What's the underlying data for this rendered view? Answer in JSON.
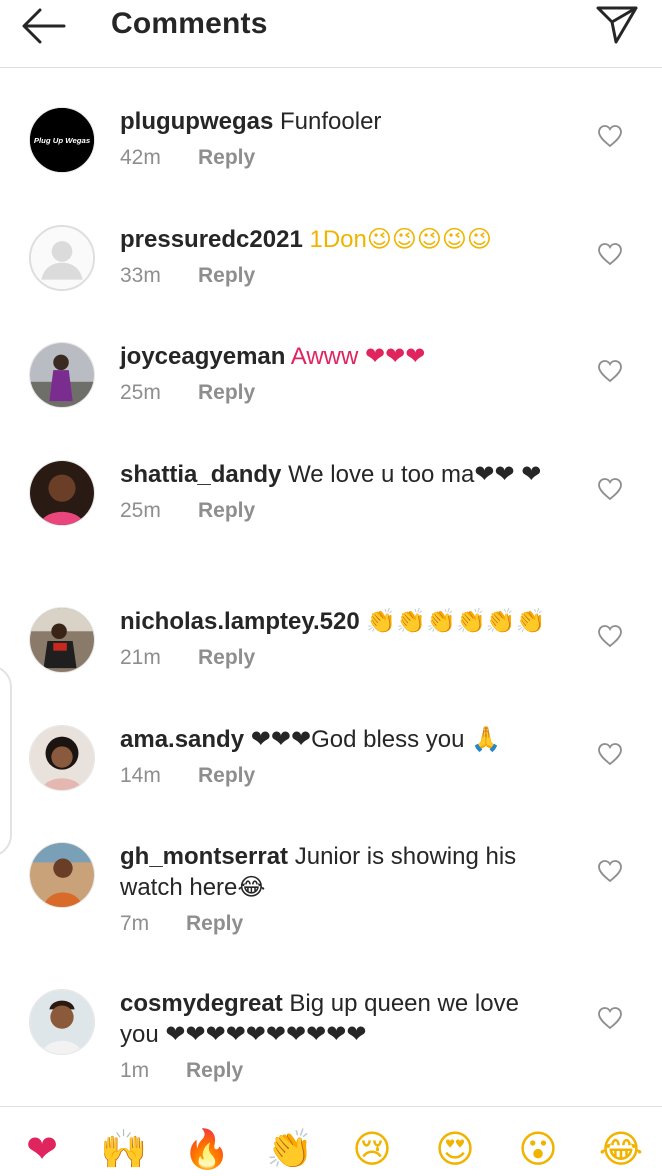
{
  "header": {
    "title": "Comments",
    "back_icon": "arrow-left-icon",
    "send_icon": "paper-plane-icon"
  },
  "colors": {
    "text": "#262626",
    "secondary": "#8e8e8e",
    "heart": "#e0245e",
    "divider": "#dcdcdc"
  },
  "comments": [
    {
      "username": "plugupwegas",
      "text": "Funfooler",
      "time": "42m",
      "reply": "Reply",
      "avatar_label": "Plug Up Wegas"
    },
    {
      "username": "pressuredc2021",
      "text": "1Don😉😉😉😉😉",
      "time": "33m",
      "reply": "Reply"
    },
    {
      "username": "joyceagyeman",
      "text": "Awww ❤❤❤",
      "time": "25m",
      "reply": "Reply"
    },
    {
      "username": "shattia_dandy",
      "text": "We love u too ma❤❤ ❤",
      "time": "25m",
      "reply": "Reply"
    },
    {
      "username": "nicholas.lamptey.520",
      "text": "👏👏👏👏👏👏",
      "time": "21m",
      "reply": "Reply"
    },
    {
      "username": "ama.sandy",
      "text": "❤❤❤God bless you 🙏",
      "time": "14m",
      "reply": "Reply"
    },
    {
      "username": "gh_montserrat",
      "text": "Junior is showing his watch here😂",
      "time": "7m",
      "reply": "Reply"
    },
    {
      "username": "cosmydegreat",
      "text": "Big up queen we love you ❤❤❤❤❤❤❤❤❤❤",
      "time": "1m",
      "reply": "Reply"
    }
  ],
  "reactions": [
    "❤",
    "🙌",
    "🔥",
    "👏",
    "😢",
    "😍",
    "😮",
    "😂"
  ]
}
